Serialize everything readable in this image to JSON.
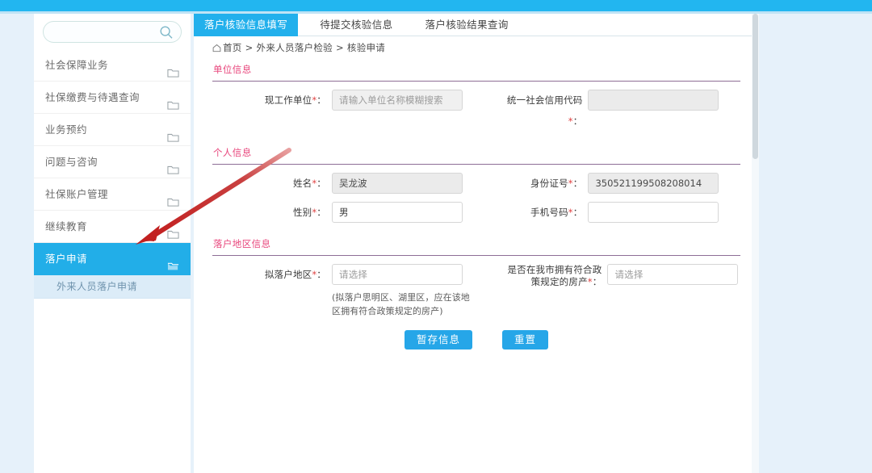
{
  "window": {
    "accent_blue": "#22b0ec",
    "section_title_color": "#e8467c",
    "annotation_color": "#cc2222"
  },
  "sidebar": {
    "search": {
      "value": "",
      "placeholder": "",
      "icon": "search-icon"
    },
    "items": [
      {
        "label": "社会保障业务",
        "icon": "folder-icon",
        "active": false
      },
      {
        "label": "社保缴费与待遇查询",
        "icon": "folder-icon",
        "active": false
      },
      {
        "label": "业务预约",
        "icon": "folder-icon",
        "active": false
      },
      {
        "label": "问题与咨询",
        "icon": "folder-icon",
        "active": false
      },
      {
        "label": "社保账户管理",
        "icon": "folder-icon",
        "active": false
      },
      {
        "label": "继续教育",
        "icon": "folder-icon",
        "active": false
      },
      {
        "label": "落户申请",
        "icon": "folder-open-icon",
        "active": true
      }
    ],
    "subitem": {
      "label": "外来人员落户申请"
    }
  },
  "tabs": [
    {
      "label": "落户核验信息填写",
      "active": true
    },
    {
      "label": "待提交核验信息",
      "active": false
    },
    {
      "label": "落户核验结果查询",
      "active": false
    }
  ],
  "breadcrumb": {
    "home_icon": "home-icon",
    "items": [
      "首页",
      "外来人员落户检验",
      "核验申请"
    ],
    "separator": ">"
  },
  "sections": {
    "unit": {
      "title": "单位信息",
      "fields": {
        "work_unit": {
          "label": "现工作单位",
          "required": "*",
          "value": "",
          "placeholder": "请输入单位名称模糊搜索",
          "type": "select",
          "disabled": true
        },
        "credit_code": {
          "label": "统一社会信用代码",
          "required": "*",
          "value": "",
          "type": "input",
          "readonly": true
        }
      }
    },
    "personal": {
      "title": "个人信息",
      "fields": {
        "name": {
          "label": "姓名",
          "required": "*",
          "value": "吴龙波",
          "type": "input",
          "readonly": true
        },
        "id_number": {
          "label": "身份证号",
          "required": "*",
          "value": "350521199508208014",
          "type": "input",
          "readonly": true
        },
        "gender": {
          "label": "性别",
          "required": "*",
          "value": "男",
          "type": "select",
          "disabled": false
        },
        "phone": {
          "label": "手机号码",
          "required": "*",
          "value": "",
          "type": "input",
          "readonly": false
        }
      }
    },
    "area": {
      "title": "落户地区信息",
      "fields": {
        "target_area": {
          "label": "拟落户地区",
          "required": "*",
          "value": "",
          "placeholder": "请选择",
          "type": "select"
        },
        "has_property": {
          "label": "是否在我市拥有符合政策规定的房产",
          "required": "*",
          "value": "",
          "placeholder": "请选择",
          "type": "select"
        }
      },
      "hint": "(拟落户思明区、湖里区，应在该地区拥有符合政策规定的房产)"
    }
  },
  "actions": {
    "save_draft": "暂存信息",
    "reset": "重置"
  }
}
